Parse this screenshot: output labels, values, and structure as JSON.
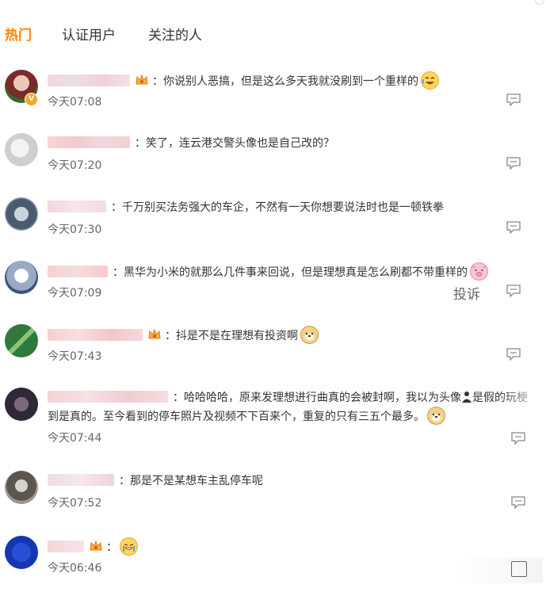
{
  "tabs": [
    {
      "label": "热门",
      "active": true
    },
    {
      "label": "认证用户",
      "active": false
    },
    {
      "label": "关注的人",
      "active": false
    }
  ],
  "colors": {
    "accent": "#ff8200",
    "text": "#333333",
    "muted": "#666666"
  },
  "comments": [
    {
      "text": "：你说别人恶搞，但是这么多天我就没刷到一个重样的",
      "time": "今天07:08",
      "verified": true,
      "vip": true,
      "emoji": "laugh-cry-emoji"
    },
    {
      "text": "：笑了，连云港交警头像也是自己改的？",
      "time": "今天07:20"
    },
    {
      "text": "：千万别买法务强大的车企，不然有一天你想要说法时也是一顿铁拳",
      "time": "今天07:30"
    },
    {
      "text": "：黑华为小米的就那么几件事来回说，但是理想真是怎么刷都不带重样的",
      "time": "今天07:09",
      "emoji": "pig-emoji",
      "report": "投诉"
    },
    {
      "text": "：抖是不是在理想有投资啊",
      "time": "今天07:43",
      "vip": true,
      "emoji": "doge-emoji"
    },
    {
      "line1": "：哈哈哈哈，原来发理想进行曲真的会被封啊，我以为头像",
      "line1b": "是假的玩梗",
      "line2": "到是真的。至今看到的停车照片及视频不下百来个，重复的只有三五个最多。",
      "time": "今天07:44",
      "emoji": "doge-emoji"
    },
    {
      "text": "：那是不是某想车主乱停车呢",
      "time": "今天07:52"
    },
    {
      "text": "：",
      "time": "今天06:46",
      "vip": true,
      "emoji": "tears-emoji"
    }
  ]
}
